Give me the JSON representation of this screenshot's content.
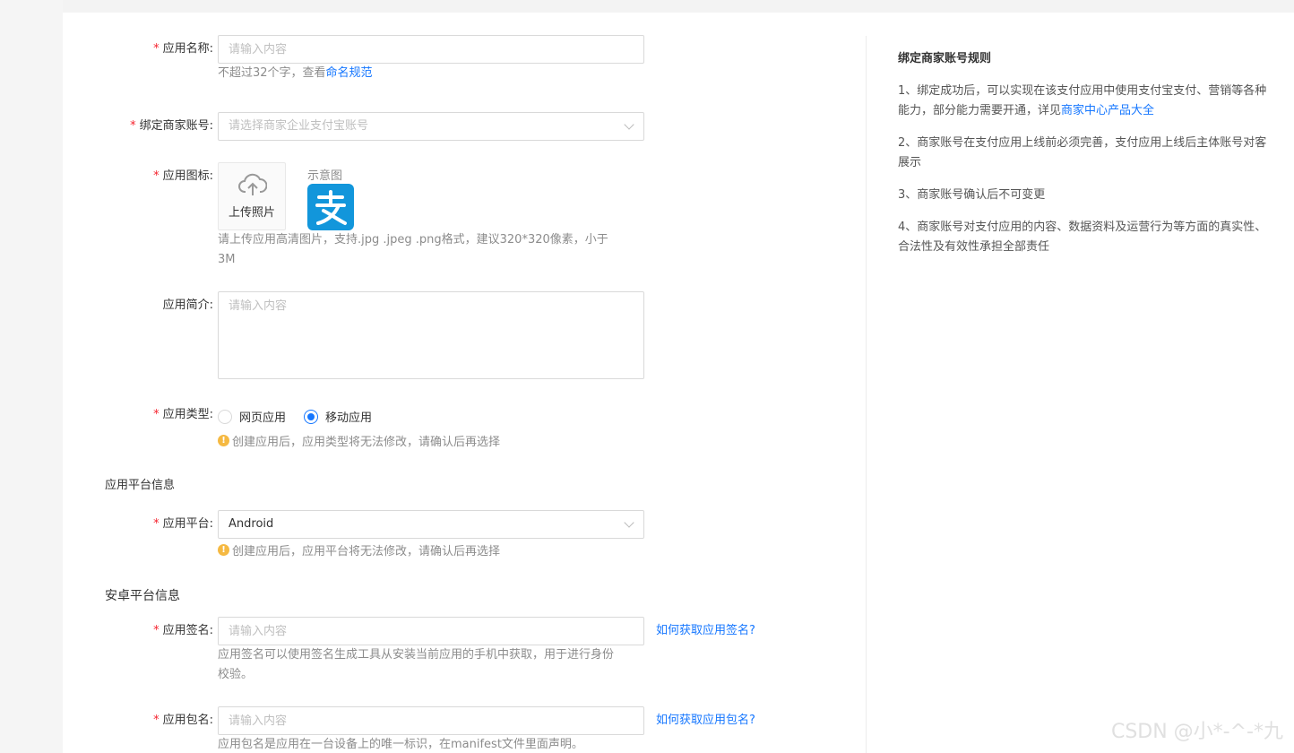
{
  "form": {
    "app_name": {
      "label": "应用名称:",
      "placeholder": "请输入内容",
      "help_prefix": "不超过32个字，查看",
      "help_link": "命名规范"
    },
    "merchant_account": {
      "label": "绑定商家账号:",
      "placeholder": "请选择商家企业支付宝账号"
    },
    "app_icon": {
      "label": "应用图标:",
      "upload_label": "上传照片",
      "demo_label": "示意图",
      "logo_char": "支",
      "help_line1": "请上传应用高清图片，支持.jpg .jpeg .png格式，建议320*320像素，小于",
      "help_line2": "3M"
    },
    "app_intro": {
      "label": "应用简介:",
      "placeholder": "请输入内容"
    },
    "app_type": {
      "label": "应用类型:",
      "options": [
        "网页应用",
        "移动应用"
      ],
      "selected": "移动应用",
      "warning": "创建应用后，应用类型将无法修改，请确认后再选择"
    },
    "platform_section_title": "应用平台信息",
    "app_platform": {
      "label": "应用平台:",
      "value": "Android",
      "warning": "创建应用后，应用平台将无法修改，请确认后再选择"
    },
    "android_section_title": "安卓平台信息",
    "app_signature": {
      "label": "应用签名:",
      "placeholder": "请输入内容",
      "side_link": "如何获取应用签名?",
      "help_line1": "应用签名可以使用签名生成工具从安装当前应用的手机中获取，用于进行身份",
      "help_line2": "校验。"
    },
    "app_package": {
      "label": "应用包名:",
      "placeholder": "请输入内容",
      "side_link": "如何获取应用包名?",
      "help": "应用包名是应用在一台设备上的唯一标识，在manifest文件里面声明。"
    }
  },
  "rules": {
    "title": "绑定商家账号规则",
    "item1_line1": "1、绑定成功后，可以实现在该支付应用中使用支付宝支付、营销等各种",
    "item1_line2_prefix": "能力，部分能力需要开通，详见",
    "item1_link": "商家中心产品大全",
    "item2_line1": "2、商家账号在支付应用上线前必须完善，支付应用上线后主体账号对客",
    "item2_line2": "展示",
    "item3": "3、商家账号确认后不可变更",
    "item4_line1": "4、商家账号对支付应用的内容、数据资料及运营行为等方面的真实性、",
    "item4_line2": "合法性及有效性承担全部责任"
  },
  "watermark": "CSDN @小*-^-*九",
  "colors": {
    "link": "#1677ff",
    "required": "#f5222d",
    "warning": "#f5b942",
    "alipay": "#1296db"
  }
}
